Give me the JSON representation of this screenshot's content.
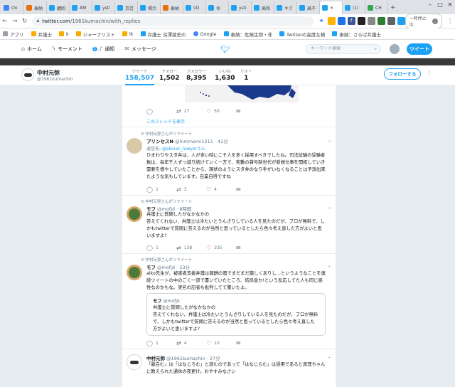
{
  "browser": {
    "tabs": [
      "On",
      "泰納",
      "鍵回",
      "AM",
      "ysti",
      "京芸",
      "揭示",
      "泰納",
      "(4)",
      "ゆ",
      "ysti",
      "高和",
      "キク",
      "高不",
      "",
      "(1)",
      "CH"
    ],
    "url_host": "twitter.com",
    "url_path": "/1961kumachin/with_replies",
    "pause_label": "一時停止中",
    "bookmarks": [
      "アプリ",
      "弁護士",
      "k",
      "ジャーナリスト",
      "lk",
      "弁護士 深澤論史の",
      "Google",
      "泰納：危険生物・非",
      "Twitterの高度な検",
      "泰納：さらば弁護士"
    ]
  },
  "twitter_nav": {
    "home": "ホーム",
    "moments": "モーメント",
    "notifications": "通知",
    "notifications_badge": "1",
    "messages": "メッセージ",
    "search_placeholder": "キーワード検索",
    "tweet_button": "ツイート"
  },
  "profile": {
    "name": "中村元弥",
    "handle": "@1961kumachin",
    "stats": [
      {
        "label": "ツイート",
        "value": "158,507"
      },
      {
        "label": "フォロー",
        "value": "1,502"
      },
      {
        "label": "フォロワー",
        "value": "8,395"
      },
      {
        "label": "いいね",
        "value": "1,630"
      },
      {
        "label": "リスト",
        "value": "1"
      }
    ],
    "follow_button": "フォローする"
  },
  "top_tweet": {
    "retweets": "27",
    "likes": "50",
    "show_thread": "このスレッドを表示"
  },
  "tweets": [
    {
      "retweeted_by": "中村元弥さんがリツイート",
      "name": "プリンセスN",
      "handle": "@himmemi1215 · 41分",
      "reply_to_prefix": "返信先: ",
      "reply_to": "@ekinan_lawyerさん",
      "body": "ひまわりやスタ弁は、人が多い時にこそ人を多く採用すべきでしたね。司法試験の受験者数は、毎年千人ずつ減り続けていく一方で、苦難の貸与制世代が新規仕事を開拓していき需要を増やしていたことから、現状のようにスタ弁のなり手がいなくなることは予測出来たような気もしています。自業自得ですね",
      "replies": "1",
      "retweets": "3",
      "likes": "4"
    },
    {
      "retweeted_by": "中村元弥さんがリツイート",
      "name": "モフ",
      "handle": "@mofjd · 8時間",
      "body": "弁護士に質問したがなかなかの\n答えてくれない、弁護士は冷たいとうんざりしている人を見たのだが、プロが無料で、しかもtwitterで質問に答えるのが当然と思っているとしたら色々考え直した方がよいと思いますよ?",
      "replies": "1",
      "retweets": "138",
      "likes": "335"
    },
    {
      "retweeted_by": "中村元弥さんがリツイート",
      "name": "モフ",
      "handle": "@mofjd · 53分",
      "body": "aiko先生が、被害者支援弁護は報酬の面でまだまだ厳しくありし…というようなことを連続ツイートの中のごく一部で書いていたところ、結局金か!という反応してた人も同じ感性なのかもな。実名の記者も批判してて驚いたよ。",
      "quote_name": "モフ",
      "quote_handle": "@mofjd",
      "quote_body": "弁護士に質問したがなかなかの\n答えてくれない、弁護士は冷たいとうんざりしている人を見たのだが、プロが無料で、しかもtwitterで質問に答えるのが当然と思っているとしたら色々考え直した方がよいと思いますよ?",
      "replies": "1",
      "retweets": "4",
      "likes": "10"
    },
    {
      "name": "中村元弥",
      "handle": "@1961kumachin · 27分",
      "body": "「暴白む」は「はなじろむ」と読むのであって「はなじらむ」は誤用であると真理ちゃんに教えられた通休の夜更け。おやすみなさい"
    }
  ],
  "colors": {
    "twitter_blue": "#1da1f2",
    "like_red": "#e0245e",
    "text_dark": "#14171a",
    "text_gray": "#657786"
  }
}
